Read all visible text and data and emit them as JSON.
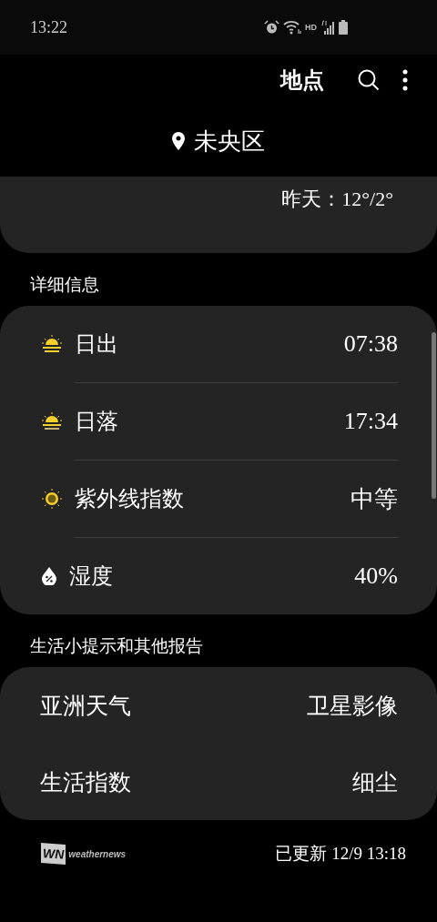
{
  "status_bar": {
    "time": "13:22",
    "network": "HD"
  },
  "header": {
    "title": "地点"
  },
  "location": {
    "name": "未央区"
  },
  "summary": {
    "yesterday": "昨天：12°/2°"
  },
  "details": {
    "title": "详细信息",
    "items": [
      {
        "kind": "sunrise",
        "label": "日出",
        "value": "07:38"
      },
      {
        "kind": "sunset",
        "label": "日落",
        "value": "17:34"
      },
      {
        "kind": "uv",
        "label": "紫外线指数",
        "value": "中等"
      },
      {
        "kind": "humidity",
        "label": "湿度",
        "value": "40%"
      }
    ]
  },
  "tips": {
    "title": "生活小提示和其他报告",
    "items": [
      {
        "label": "亚洲天气",
        "value": "卫星影像"
      },
      {
        "label": "生活指数",
        "value": "细尘"
      }
    ]
  },
  "footer": {
    "logo_mark": "WN",
    "logo_text": "weathernews",
    "updated": "已更新 12/9 13:18"
  }
}
